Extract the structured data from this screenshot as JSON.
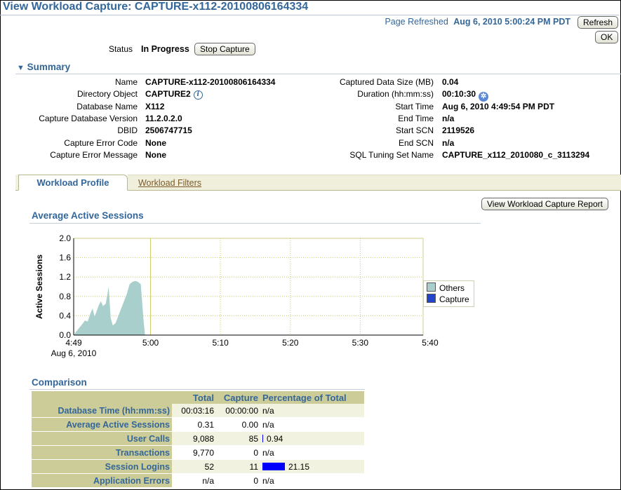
{
  "page": {
    "title": "View Workload Capture: CAPTURE-x112-20100806164334",
    "refreshed_label": "Page Refreshed",
    "refreshed_value": "Aug 6, 2010 5:00:24 PM PDT",
    "refresh_button": "Refresh",
    "ok_button": "OK"
  },
  "status": {
    "label": "Status",
    "value": "In Progress",
    "stop_button": "Stop Capture"
  },
  "summary": {
    "heading": "Summary",
    "left": [
      {
        "label": "Name",
        "value": "CAPTURE-x112-20100806164334"
      },
      {
        "label": "Directory Object",
        "value": "CAPTURE2"
      },
      {
        "label": "Database Name",
        "value": "X112"
      },
      {
        "label": "Capture Database Version",
        "value": "11.2.0.2.0"
      },
      {
        "label": "DBID",
        "value": "2506747715"
      },
      {
        "label": "Capture Error Code",
        "value": "None"
      },
      {
        "label": "Capture Error Message",
        "value": "None"
      }
    ],
    "right": [
      {
        "label": "Captured Data Size (MB)",
        "value": "0.04"
      },
      {
        "label": "Duration (hh:mm:ss)",
        "value": "00:10:30"
      },
      {
        "label": "Start Time",
        "value": "Aug 6, 2010 4:49:54 PM PDT"
      },
      {
        "label": "End Time",
        "value": "n/a"
      },
      {
        "label": "Start SCN",
        "value": "2119526"
      },
      {
        "label": "End SCN",
        "value": "n/a"
      },
      {
        "label": "SQL Tuning Set Name",
        "value": "CAPTURE_x112_2010080_c_3113294"
      }
    ]
  },
  "tabs": [
    {
      "label": "Workload Profile",
      "active": true
    },
    {
      "label": "Workload Filters",
      "active": false
    }
  ],
  "report_button": "View Workload Capture Report",
  "chart_section": "Average Active Sessions",
  "chart_data": {
    "type": "area",
    "title": "",
    "ylabel": "Active Sessions",
    "xlabel": "",
    "ylim": [
      0,
      2.0
    ],
    "yticks": [
      "0.0",
      "0.4",
      "0.8",
      "1.2",
      "1.6",
      "2.0"
    ],
    "xticks": [
      "4:49",
      "5:00",
      "5:10",
      "5:20",
      "5:30",
      "5:40"
    ],
    "x_date_label": "Aug 6, 2010",
    "grid": true,
    "legend_position": "right",
    "colors": {
      "Others": "#a9cfcc",
      "Capture": "#2244cc"
    },
    "series": [
      {
        "name": "Others",
        "values": [
          0,
          0.08,
          0.15,
          0.22,
          0.3,
          0.28,
          0.45,
          0.55,
          0.38,
          0.5,
          0.62,
          0.7,
          0.6,
          0.65,
          1.0,
          0.35,
          0.2,
          0.25,
          0.4,
          0.55,
          0.7,
          0.85,
          1.05,
          1.1,
          1.12,
          1.1,
          1.05,
          0.3,
          0
        ]
      },
      {
        "name": "Capture",
        "values": [
          0,
          0,
          0,
          0,
          0,
          0,
          0,
          0,
          0,
          0,
          0,
          0,
          0,
          0,
          0,
          0,
          0,
          0,
          0,
          0,
          0,
          0,
          0,
          0,
          0,
          0,
          0,
          0,
          0
        ]
      }
    ],
    "x_minutes": [
      0,
      0.4,
      0.8,
      1.2,
      1.6,
      2.0,
      2.4,
      2.7,
      3.0,
      3.3,
      3.6,
      3.9,
      4.2,
      4.6,
      5.0,
      5.3,
      5.6,
      6.0,
      6.4,
      6.8,
      7.2,
      7.6,
      8.0,
      8.4,
      8.8,
      9.2,
      9.6,
      10.0,
      10.2
    ]
  },
  "comparison": {
    "heading": "Comparison",
    "columns": [
      "",
      "Total",
      "Capture",
      "Percentage of Total"
    ],
    "rows": [
      {
        "label": "Database Time (hh:mm:ss)",
        "total": "00:03:16",
        "capture": "00:00:00",
        "pct": "n/a",
        "pct_value": 0
      },
      {
        "label": "Average Active Sessions",
        "total": "0.31",
        "capture": "0.00",
        "pct": "n/a",
        "pct_value": 0
      },
      {
        "label": "User Calls",
        "total": "9,088",
        "capture": "85",
        "pct": "0.94",
        "pct_value": 0.94
      },
      {
        "label": "Transactions",
        "total": "9,770",
        "capture": "0",
        "pct": "n/a",
        "pct_value": 0
      },
      {
        "label": "Session Logins",
        "total": "52",
        "capture": "11",
        "pct": "21.15",
        "pct_value": 21.15
      },
      {
        "label": "Application Errors",
        "total": "n/a",
        "capture": "0",
        "pct": "n/a",
        "pct_value": 0
      }
    ]
  }
}
